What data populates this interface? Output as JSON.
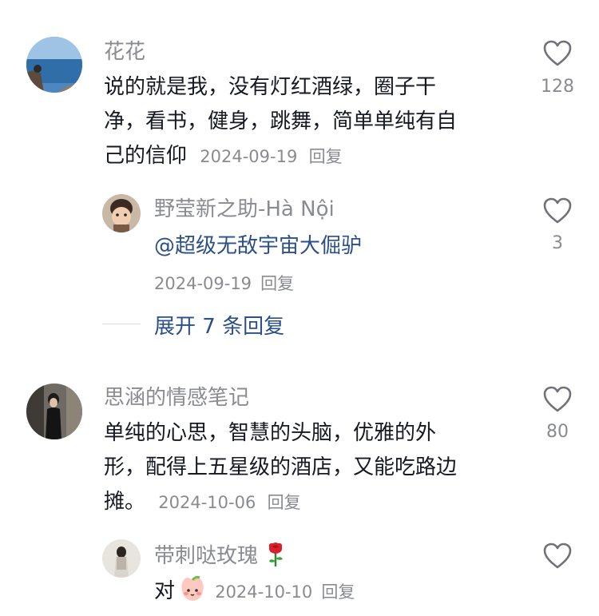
{
  "comments": [
    {
      "user": "花花",
      "text_lines": [
        "说的就是我，没有灯红酒绿，圈子干",
        "净，看书，健身，跳舞，简单单纯有自",
        "己的信仰"
      ],
      "date": "2024-09-19",
      "reply_label": "回复",
      "likes": "128",
      "icons": {
        "avatar": "avatar-sea-photo",
        "like": "heart-outline-icon"
      }
    },
    {
      "user": "思涵的情感笔记",
      "text_lines": [
        "单纯的心思，智慧的头脑，优雅的外",
        "形，配得上五星级的酒店，又能吃路边",
        "摊。"
      ],
      "date": "2024-10-06",
      "reply_label": "回复",
      "likes": "80",
      "icons": {
        "avatar": "avatar-woman-qipao-photo",
        "like": "heart-outline-icon"
      }
    }
  ],
  "replies": [
    {
      "user": "野莹新之助-Hà Nội",
      "mention": "@超级无敌宇宙大倔驴",
      "date": "2024-09-19",
      "reply_label": "回复",
      "likes": "3",
      "icons": {
        "avatar": "avatar-child-photo",
        "like": "heart-outline-icon"
      }
    },
    {
      "user": "带刺哒玫瑰",
      "text": "对",
      "date": "2024-10-10",
      "reply_label": "回复",
      "likes": "",
      "icons": {
        "avatar": "avatar-girl-photo",
        "like": "heart-outline-icon",
        "name_emoji": "rose-icon",
        "text_emoji": "peach-face-icon"
      }
    }
  ],
  "expand_replies": "展开 7 条回复",
  "colors": {
    "name": "#8a8b91",
    "text": "#161823",
    "link": "#2b4f8a"
  }
}
